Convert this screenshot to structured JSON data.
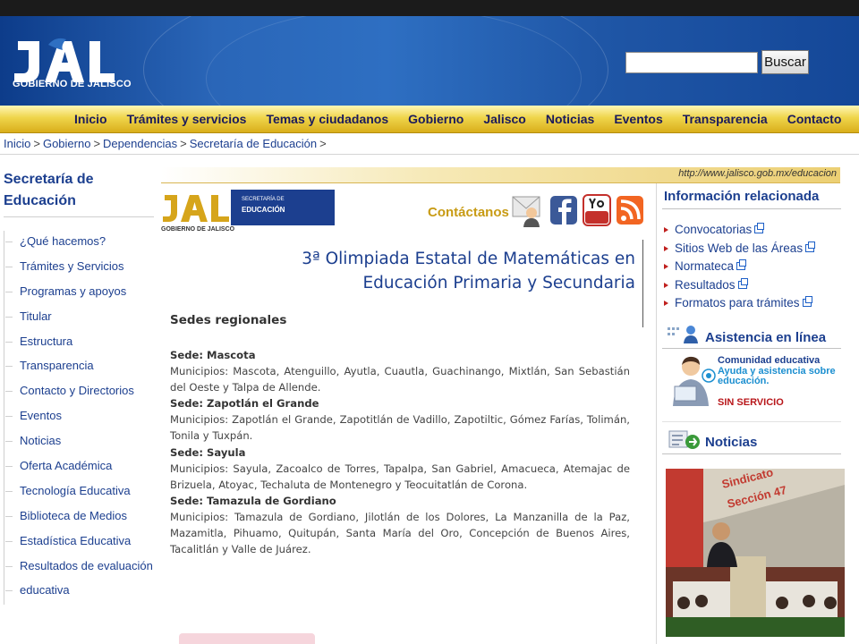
{
  "header": {
    "logo_text": "GOBIERNO DE JALISCO",
    "search_placeholder": "",
    "search_button": "Buscar"
  },
  "nav": {
    "items": [
      "Inicio",
      "Trámites y servicios",
      "Temas y ciudadanos",
      "Gobierno",
      "Jalisco",
      "Noticias",
      "Eventos",
      "Transparencia",
      "Contacto"
    ]
  },
  "breadcrumb": {
    "items": [
      "Inicio",
      "Gobierno",
      "Dependencias",
      "Secretaría de Educación"
    ],
    "separator": ">"
  },
  "sidebar": {
    "title_line1": "Secretaría de",
    "title_line2": "Educación",
    "items": [
      "¿Qué hacemos?",
      "Trámites y Servicios",
      "Programas y apoyos",
      "Titular",
      "Estructura",
      "Transparencia",
      "Contacto y Directorios",
      "Eventos",
      "Noticias",
      "Oferta Académica",
      "Tecnología Educativa",
      "Biblioteca de Medios",
      "Estadística Educativa",
      "Resultados de evaluación",
      "educativa"
    ]
  },
  "main": {
    "url": "http://www.jalisco.gob.mx/educacion",
    "sec_logo_line1": "SECRETARÍA DE",
    "sec_logo_line2": "EDUCACIÓN",
    "sec_logo_gob": "GOBIERNO DE JALISCO",
    "contact_label": "Contáctanos",
    "title_line1": "3ª Olimpiada Estatal de Matemáticas en",
    "title_line2": "Educación Primaria y Secundaria",
    "sedes_title": "Sedes regionales",
    "sedes": [
      {
        "name": "Sede: Mascota",
        "municipios": "Municipios: Mascota, Atenguillo, Ayutla, Cuautla, Guachinango, Mixtlán, San Sebastián del Oeste y Talpa de Allende."
      },
      {
        "name": "Sede: Zapotlán el Grande",
        "municipios": "Municipios: Zapotlán el Grande, Zapotitlán de Vadillo, Zapotiltic, Gómez Farías, Tolimán, Tonila y Tuxpán."
      },
      {
        "name": "Sede: Sayula",
        "municipios": "Municipios: Sayula, Zacoalco de Torres, Tapalpa, San Gabriel, Amacueca, Atemajac de Brizuela, Atoyac, Techaluta de Montenegro y  Teocuitatlán de Corona."
      },
      {
        "name": "Sede:  Tamazula de Gordiano",
        "municipios": "Municipios: Tamazula de Gordiano, Jilotlán de los Dolores, La Manzanilla de la Paz, Mazamitla, Pihuamo, Quitupán, Santa María del Oro, Concepción de Buenos Aires, Tacalitlán y Valle de Juárez."
      }
    ]
  },
  "right": {
    "info_title": "Información relacionada",
    "info_items": [
      "Convocatorias",
      "Sitios Web de las Áreas",
      "Normateca",
      "Resultados",
      "Formatos para trámites"
    ],
    "asist_title": "Asistencia en línea",
    "community_title": "Comunidad educativa",
    "community_desc": "Ayuda y asistencia sobre educación.",
    "community_status": "SIN SERVICIO",
    "news_title": "Noticias",
    "news_banner_1": "Sindicato",
    "news_banner_2": "Sección 47"
  },
  "icons": {
    "social": [
      "email-icon",
      "facebook-icon",
      "youtube-icon",
      "rss-icon"
    ]
  },
  "colors": {
    "brand_blue": "#1c3f8f",
    "nav_gold": "#e6c43a",
    "accent_red": "#c0201e"
  }
}
